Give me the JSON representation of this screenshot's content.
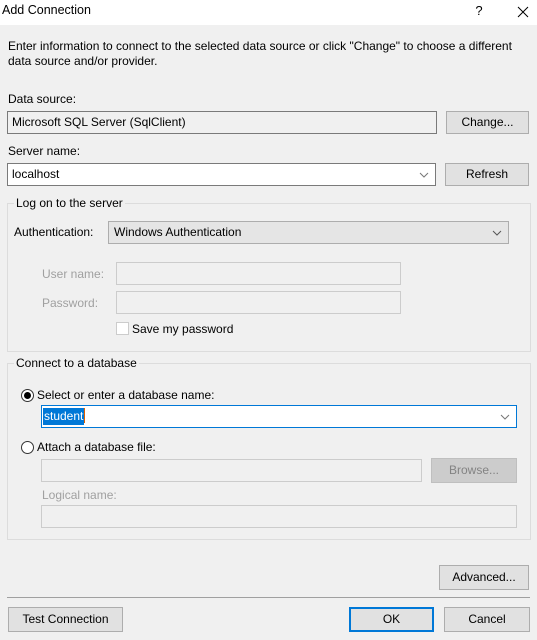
{
  "window": {
    "title": "Add Connection",
    "help_icon": "?",
    "close_icon": "✕"
  },
  "intro_text": "Enter information to connect to the selected data source or click \"Change\" to choose a different data source and/or provider.",
  "data_source": {
    "label": "Data source:",
    "value": "Microsoft SQL Server (SqlClient)",
    "change_button": "Change..."
  },
  "server": {
    "label": "Server name:",
    "value": "localhost",
    "refresh_button": "Refresh"
  },
  "logon_group": {
    "legend": "Log on to the server",
    "auth_label": "Authentication:",
    "auth_value": "Windows Authentication",
    "username_label": "User name:",
    "username_value": "",
    "password_label": "Password:",
    "password_value": "",
    "save_password_label": "Save my password",
    "save_password_checked": false
  },
  "database_group": {
    "legend": "Connect to a database",
    "select_radio_label": "Select or enter a database name:",
    "select_radio_checked": true,
    "database_name": "student",
    "attach_radio_label": "Attach a database file:",
    "attach_radio_checked": false,
    "file_path": "",
    "browse_button": "Browse...",
    "logical_name_label": "Logical name:",
    "logical_name_value": ""
  },
  "footer": {
    "advanced_button": "Advanced...",
    "test_connection_button": "Test Connection",
    "ok_button": "OK",
    "cancel_button": "Cancel"
  },
  "colors": {
    "accent": "#0078d7",
    "background": "#f0f0f0",
    "caret": "#e06000"
  }
}
